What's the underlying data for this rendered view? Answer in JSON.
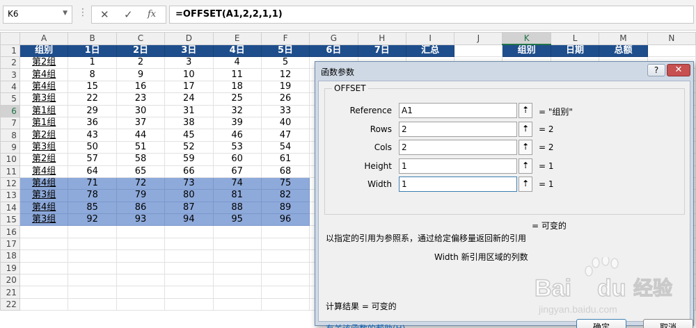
{
  "formula_bar": {
    "name_box": "K6",
    "separator": "⋮",
    "cancel_glyph": "✕",
    "enter_glyph": "✓",
    "fx_glyph": "fx",
    "formula": "=OFFSET(A1,2,2,1,1)"
  },
  "sheet": {
    "columns": [
      "A",
      "B",
      "C",
      "D",
      "E",
      "F",
      "G",
      "H",
      "I",
      "J",
      "K",
      "L",
      "M",
      "N"
    ],
    "selected_column": "K",
    "selected_row": 6,
    "header_row": [
      "组别",
      "1日",
      "2日",
      "3日",
      "4日",
      "5日",
      "6日",
      "7日",
      "汇总"
    ],
    "rows": [
      [
        "第2组",
        "1",
        "2",
        "3",
        "4",
        "5"
      ],
      [
        "第4组",
        "8",
        "9",
        "10",
        "11",
        "12"
      ],
      [
        "第4组",
        "15",
        "16",
        "17",
        "18",
        "19"
      ],
      [
        "第3组",
        "22",
        "23",
        "24",
        "25",
        "26"
      ],
      [
        "第1组",
        "29",
        "30",
        "31",
        "32",
        "33"
      ],
      [
        "第1组",
        "36",
        "37",
        "38",
        "39",
        "40"
      ],
      [
        "第2组",
        "43",
        "44",
        "45",
        "46",
        "47"
      ],
      [
        "第3组",
        "50",
        "51",
        "52",
        "53",
        "54"
      ],
      [
        "第2组",
        "57",
        "58",
        "59",
        "60",
        "61"
      ],
      [
        "第4组",
        "64",
        "65",
        "66",
        "67",
        "68"
      ],
      [
        "第4组",
        "71",
        "72",
        "73",
        "74",
        "75"
      ],
      [
        "第3组",
        "78",
        "79",
        "80",
        "81",
        "82"
      ],
      [
        "第4组",
        "85",
        "86",
        "87",
        "88",
        "89"
      ],
      [
        "第3组",
        "92",
        "93",
        "94",
        "95",
        "96"
      ]
    ],
    "highlighted_rows": [
      12,
      13,
      14,
      15
    ],
    "side_header": [
      "组别",
      "日期",
      "总额"
    ],
    "total_rows": 22,
    "header_color": "#1f4e8c",
    "highlight_color": "#8eaadb",
    "accent_color": "#217346"
  },
  "dialog": {
    "title": "函数参数",
    "help_glyph": "?",
    "close_glyph": "✕",
    "function_name": "OFFSET",
    "args": [
      {
        "label": "Reference",
        "value": "A1",
        "result": "=  \"组别\""
      },
      {
        "label": "Rows",
        "value": "2",
        "result": "=  2"
      },
      {
        "label": "Cols",
        "value": "2",
        "result": "=  2"
      },
      {
        "label": "Height",
        "value": "1",
        "result": "=  1"
      },
      {
        "label": "Width",
        "value": "1",
        "result": "=  1"
      }
    ],
    "ref_button_glyph": "⇡",
    "formula_result": "=  可变的",
    "description": "以指定的引用为参照系，通过给定偏移量返回新的引用",
    "param_description": "Width   新引用区域的列数",
    "calc_result": "计算结果 =   可变的",
    "help_link": "有关该函数的帮助(H)",
    "ok_label": "确定",
    "cancel_label": "取消"
  },
  "watermark": {
    "brand": "Bai",
    "brand_tail": "du",
    "brand_cn": "经验",
    "url": "jingyan.baidu.com"
  }
}
